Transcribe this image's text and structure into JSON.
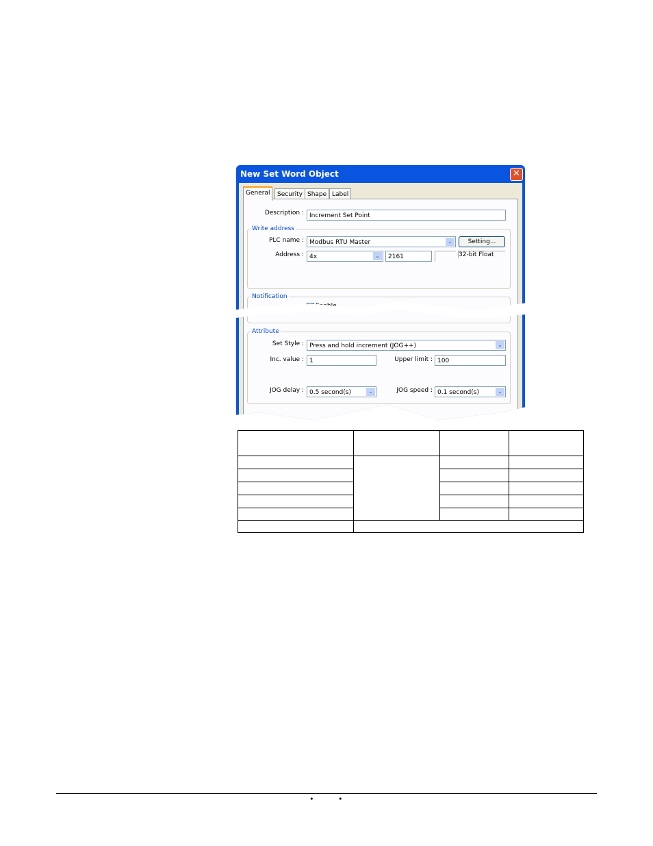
{
  "dialog": {
    "title": "New  Set Word Object",
    "tabs": [
      "General",
      "Security",
      "Shape",
      "Label"
    ],
    "description_label": "Description :",
    "description_value": "Increment Set Point",
    "write_address": {
      "group": "Write address",
      "plc_label": "PLC name :",
      "plc_value": "Modbus RTU Master",
      "setting_button": "Setting...",
      "address_label": "Address :",
      "address_type": "4x",
      "address_value": "2161",
      "data_format": "32-bit Float"
    },
    "notification": {
      "group": "Notification",
      "enable_label": "Enable",
      "enabled": false
    },
    "attribute": {
      "group": "Attribute",
      "set_style_label": "Set Style :",
      "set_style_value": "Press and hold increment (JOG++)",
      "inc_label": "Inc. value :",
      "inc_value": "1",
      "upper_label": "Upper limit :",
      "upper_value": "100",
      "jog_delay_label": "JOG delay :",
      "jog_delay_value": "0.5  second(s)",
      "jog_speed_label": "JOG speed :",
      "jog_speed_value": "0.1  second(s)"
    }
  },
  "footer": {
    "bullets": [
      "•",
      "•"
    ]
  }
}
